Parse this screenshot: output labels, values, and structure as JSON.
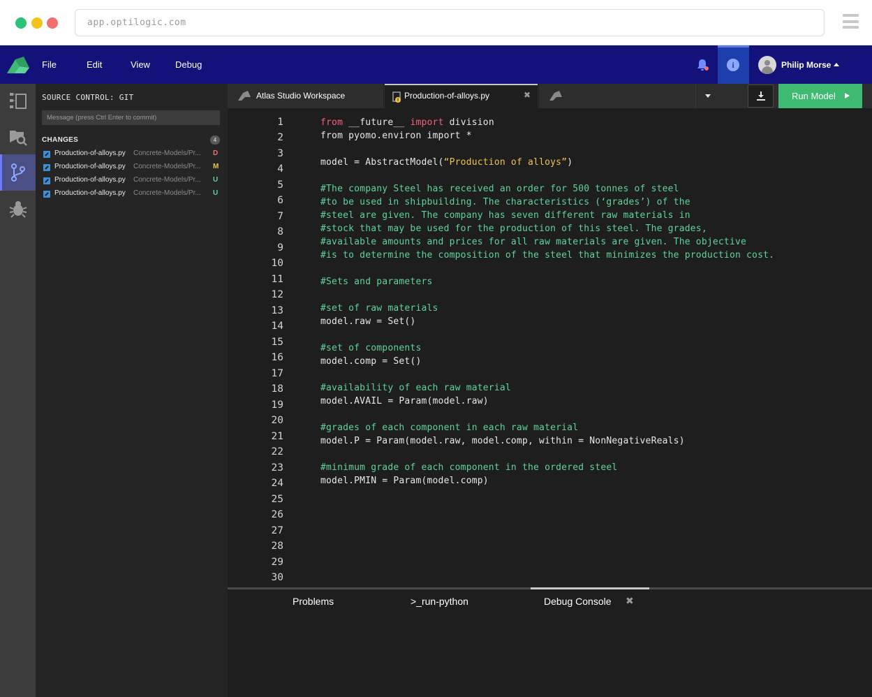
{
  "browser": {
    "url": "app.optilogic.com",
    "dots": [
      "#2cc27a",
      "#f5c21b",
      "#f26d6d"
    ]
  },
  "menubar": {
    "items": [
      "File",
      "Edit",
      "View",
      "Debug"
    ],
    "user_name": "Philip Morse"
  },
  "sidebar": {
    "title": "SOURCE CONTROL: GIT",
    "commit_placeholder": "Message (press Ctrl Enter to commit)",
    "changes_label": "CHANGES",
    "changes_count": "4",
    "changes": [
      {
        "file": "Production-of-alloys.py",
        "path": "Concrete-Models/Pr...",
        "status": "D",
        "status_color": "#f26d6d"
      },
      {
        "file": "Production-of-alloys.py",
        "path": "Concrete-Models/Pr...",
        "status": "M",
        "status_color": "#f0c253"
      },
      {
        "file": "Production-of-alloys.py",
        "path": "Concrete-Models/Pr...",
        "status": "U",
        "status_color": "#5fd49a"
      },
      {
        "file": "Production-of-alloys.py",
        "path": "Concrete-Models/Pr...",
        "status": "U",
        "status_color": "#5fd49a"
      }
    ]
  },
  "tabs": [
    {
      "label": "Atlas Studio Workspace"
    },
    {
      "label": "Production-of-alloys.py"
    },
    {
      "label": ""
    }
  ],
  "toolbar": {
    "run_label": "Run Model"
  },
  "editor": {
    "lines": [
      {
        "n": "1",
        "text": ""
      },
      {
        "n": "2",
        "text": ""
      },
      {
        "n": "3",
        "text": ""
      },
      {
        "n": "4",
        "text": ""
      },
      {
        "n": "5",
        "text": "#The company Steel has received an order for 500 tonnes of steel"
      },
      {
        "n": "6",
        "text": "#to be used in shipbuilding. The characteristics (‘grades’) of the"
      },
      {
        "n": "7",
        "text": "#steel are given. The company has seven different raw materials in"
      },
      {
        "n": "8",
        "text": "#stock that may be used for the production of this steel. The grades,"
      },
      {
        "n": "9",
        "text": "#available amounts and prices for all raw materials are given. The objective"
      },
      {
        "n": "10",
        "text": "#is to determine the composition of the steel that minimizes the production cost."
      },
      {
        "n": "11",
        "text": "#Sets and parameters"
      },
      {
        "n": "12",
        "text": ""
      },
      {
        "n": "13",
        "text": "#set of raw materials"
      },
      {
        "n": "14",
        "text": "model.raw = Set()"
      },
      {
        "n": "15",
        "text": "#set of components"
      },
      {
        "n": "16",
        "text": "model.comp = Set()"
      },
      {
        "n": "17",
        "text": ""
      },
      {
        "n": "18",
        "text": "#availability of each raw material"
      },
      {
        "n": "19",
        "text": "model.AVAIL = Param(model.raw)"
      },
      {
        "n": "20",
        "text": "#grades of each component in each raw material"
      },
      {
        "n": "21",
        "text": "model.P = Param(model.raw, model.comp, within = NonNegativeReals)"
      },
      {
        "n": "22",
        "text": ""
      },
      {
        "n": "23",
        "text": "#minimum grade of each component in the ordered steel"
      },
      {
        "n": "24",
        "text": "model.PMIN = Param(model.comp)"
      },
      {
        "n": "25",
        "text": ""
      },
      {
        "n": "26",
        "text": ""
      },
      {
        "n": "27",
        "text": ""
      },
      {
        "n": "28",
        "text": ""
      },
      {
        "n": "29",
        "text": ""
      },
      {
        "n": "30",
        "text": ""
      }
    ],
    "line1": {
      "kw1": "from",
      "mid": " __future__ ",
      "kw2": "import",
      "rest": " division"
    },
    "line2": "from pyomo.environ import *",
    "line3": {
      "pre": "model = AbstractModel(",
      "str": "“Production of alloys”",
      "post": ")"
    }
  },
  "bottom_panel": {
    "tabs": [
      "Problems",
      ">_run-python",
      "Debug Console"
    ]
  },
  "colors": {
    "menubar": "#13127a",
    "run_button": "#3fba73",
    "keyword": "#f2607c",
    "string": "#f0c253",
    "comment": "#5fd49a"
  }
}
